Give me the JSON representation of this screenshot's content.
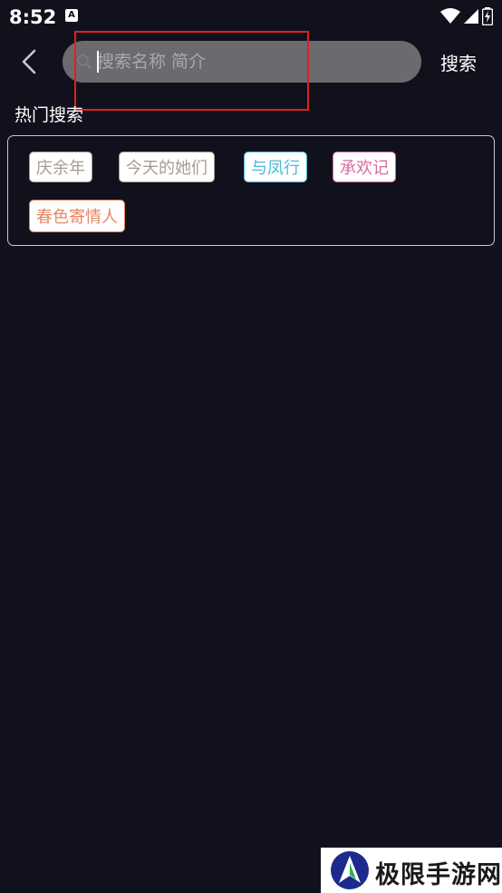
{
  "status": {
    "time": "8:52",
    "notification_letter": "A"
  },
  "header": {
    "search_placeholder": "搜索名称 简介",
    "search_value": "",
    "search_button_label": "搜索"
  },
  "hot_search": {
    "title": "热门搜索",
    "tags": [
      {
        "label": "庆余年",
        "color": "#a89b94"
      },
      {
        "label": "今天的她们",
        "color": "#a89b94"
      },
      {
        "label": "与凤行",
        "color": "#4fb9d8"
      },
      {
        "label": "承欢记",
        "color": "#d96b9c"
      },
      {
        "label": "春色寄情人",
        "color": "#e98762"
      }
    ]
  },
  "watermark": {
    "text": "极限手游网"
  },
  "colors": {
    "background": "#11111d",
    "search_box": "#6b6b6f",
    "highlight": "#e02020"
  }
}
